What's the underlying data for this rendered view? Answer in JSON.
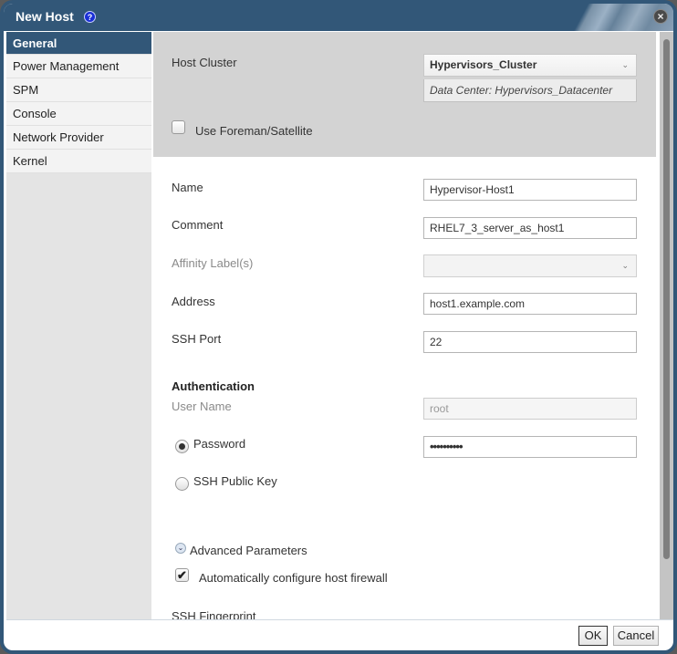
{
  "dialog": {
    "title": "New Host",
    "help_icon": "?",
    "close_icon": "×"
  },
  "sidebar": {
    "items": [
      {
        "label": "General",
        "active": true
      },
      {
        "label": "Power Management",
        "active": false
      },
      {
        "label": "SPM",
        "active": false
      },
      {
        "label": "Console",
        "active": false
      },
      {
        "label": "Network Provider",
        "active": false
      },
      {
        "label": "Kernel",
        "active": false
      }
    ]
  },
  "general": {
    "host_cluster": {
      "label": "Host Cluster",
      "value": "Hypervisors_Cluster",
      "data_center_info": "Data Center: Hypervisors_Datacenter"
    },
    "use_foreman": {
      "label": "Use Foreman/Satellite",
      "checked": false
    },
    "name": {
      "label": "Name",
      "value": "Hypervisor-Host1"
    },
    "comment": {
      "label": "Comment",
      "value": "RHEL7_3_server_as_host1"
    },
    "affinity_labels": {
      "label": "Affinity Label(s)",
      "value": "",
      "disabled": true
    },
    "address": {
      "label": "Address",
      "value": "host1.example.com"
    },
    "ssh_port": {
      "label": "SSH Port",
      "value": "22"
    },
    "authentication": {
      "heading": "Authentication",
      "user_name": {
        "label": "User Name",
        "value": "root",
        "disabled": true
      },
      "password": {
        "label": "Password",
        "selected": true,
        "value": "••••••••••"
      },
      "ssh_public_key": {
        "label": "SSH Public Key",
        "selected": false
      }
    },
    "advanced_parameters": {
      "label": "Advanced Parameters",
      "expanded": false
    },
    "auto_firewall": {
      "label": "Automatically configure host firewall",
      "checked": true
    },
    "ssh_fingerprint": {
      "label": "SSH Fingerprint"
    }
  },
  "footer": {
    "ok_label": "OK",
    "cancel_label": "Cancel"
  },
  "colors": {
    "titlebar": "#325778",
    "sidebar_active": "#325778",
    "cluster_area_bg": "#d3d3d3"
  }
}
